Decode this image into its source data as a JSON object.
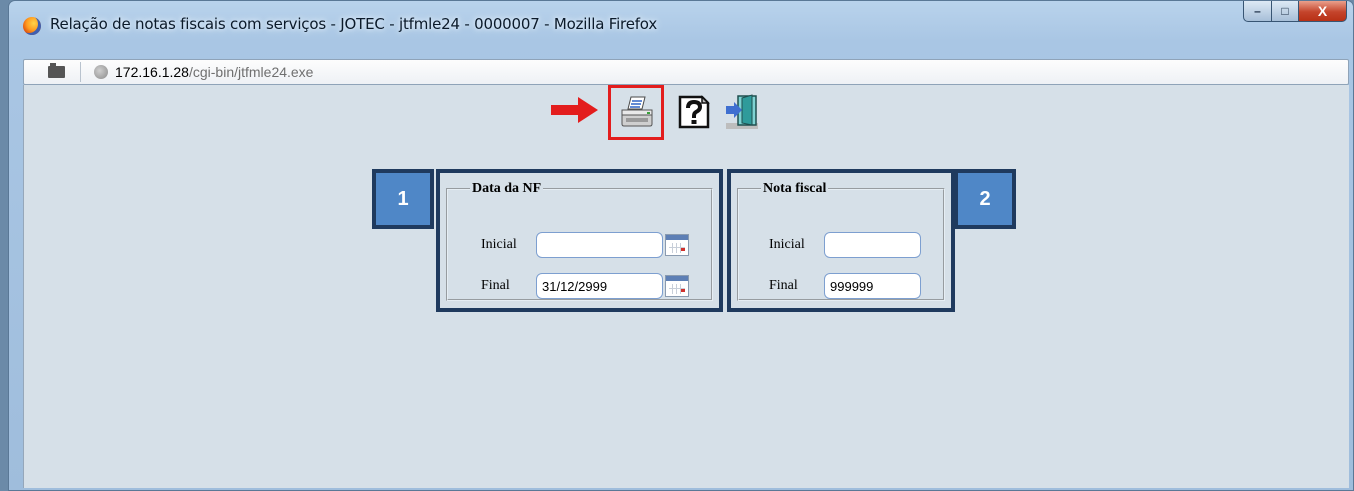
{
  "window": {
    "title": "Relação de notas fiscais com serviços - JOTEC - jtfmle24 - 0000007 - Mozilla Firefox",
    "min_symbol": "–",
    "max_symbol": "□",
    "close_symbol": "X"
  },
  "urlbar": {
    "host": "172.16.1.28",
    "path": "/cgi-bin/jtfmle24.exe"
  },
  "toolbar": {
    "arrow_icon": "red-arrow-right-icon",
    "items": [
      {
        "icon": "printer-icon"
      },
      {
        "icon": "help-icon"
      },
      {
        "icon": "exit-door-icon"
      }
    ],
    "highlight_color": "#e31d1d"
  },
  "callouts": {
    "first": "1",
    "second": "2",
    "color": "#4f87c7",
    "border_color": "#1f3a5e"
  },
  "data_nf": {
    "legend": "Data da NF",
    "inicial_label": "Inicial",
    "inicial_value": "",
    "final_label": "Final",
    "final_value": "31/12/2999"
  },
  "nota_fiscal": {
    "legend": "Nota fiscal",
    "inicial_label": "Inicial",
    "inicial_value": "",
    "final_label": "Final",
    "final_value": "999999"
  }
}
